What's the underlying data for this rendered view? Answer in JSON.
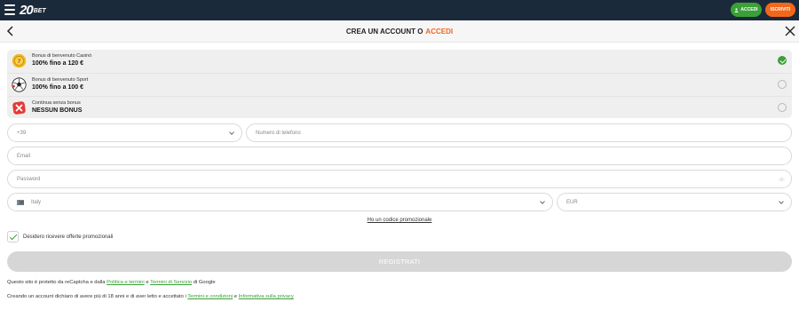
{
  "topbar": {
    "logo_number": "20",
    "logo_suffix": "BET",
    "login_label": "ACCEDI",
    "register_label": "ISCRIVITI",
    "colors": {
      "bar": "#1b2a3a",
      "login": "#3aa037",
      "register": "#f3671b"
    }
  },
  "header": {
    "title": "CREA UN ACCOUNT O",
    "title_link": "ACCEDI",
    "accent_color": "#f3671b"
  },
  "bonuses": [
    {
      "icon": "casino-chip-icon",
      "subtitle": "Bonus di benvenuto Casinò",
      "title": "100% fino a 120 €",
      "selected": true
    },
    {
      "icon": "football-icon",
      "subtitle": "Bonus di benvenuto Sport",
      "title": "100% fino a 100 €",
      "selected": false
    },
    {
      "icon": "no-bonus-icon",
      "subtitle": "Continua senza bonus",
      "title": "NESSUN BONUS",
      "selected": false
    }
  ],
  "form": {
    "phone_prefix": "+39",
    "phone_placeholder": "Numero di telefono",
    "email_placeholder": "Email",
    "password_placeholder": "Password",
    "country": "Italy",
    "currency": "EUR",
    "promo_code_link": "Ho un codice promozionale",
    "offers_checkbox_label": "Desidero ricevere offerte promozionali",
    "offers_checked": true,
    "submit_label": "REGISTRATI"
  },
  "legal": {
    "line1_prefix": "Questo sito è protetto da reCaptcha e dalla",
    "line1_link1": "Politica e termini",
    "line1_and": "e",
    "line1_link2": "Termini di Servizio",
    "line1_suffix": "di Google",
    "line2_prefix": "Creando un account dichiaro di avere più di 18 anni e di aver letto e accettato i",
    "line2_link1": "Termini e condizioni",
    "line2_and": "e",
    "line2_link2": "Informativa sulla privacy"
  }
}
